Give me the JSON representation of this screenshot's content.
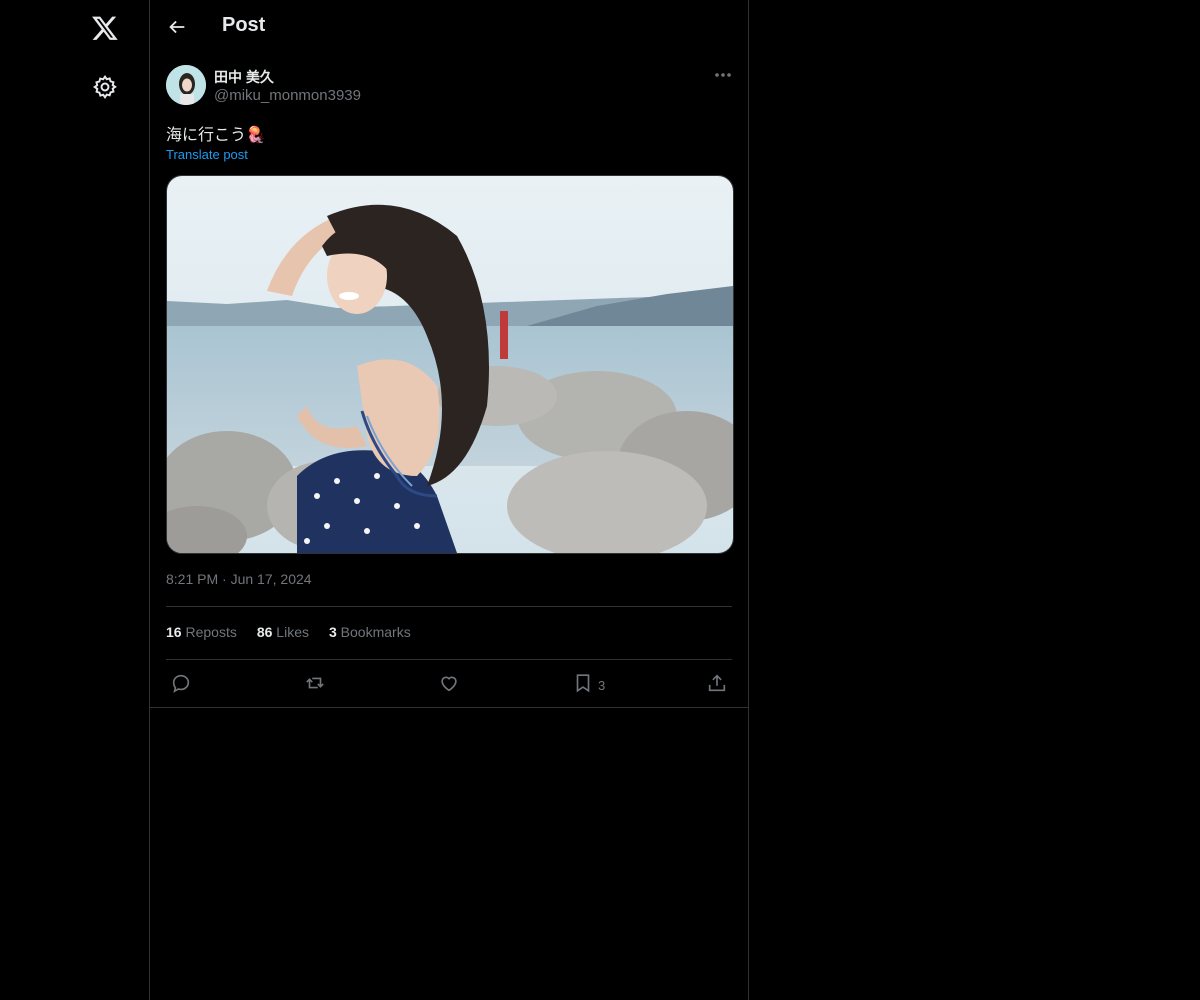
{
  "header": {
    "title": "Post"
  },
  "author": {
    "display_name": "田中 美久",
    "handle": "@miku_monmon3939"
  },
  "post": {
    "text": "海に行こう🪼",
    "translate_label": "Translate post",
    "time": "8:21 PM",
    "separator": "·",
    "date": "Jun 17, 2024"
  },
  "stats": {
    "reposts_count": "16",
    "reposts_label": "Reposts",
    "likes_count": "86",
    "likes_label": "Likes",
    "bookmarks_count": "3",
    "bookmarks_label": "Bookmarks"
  },
  "actions": {
    "bookmark_count": "3"
  },
  "icons": [
    "x-logo-icon",
    "gear-icon",
    "back-arrow-icon",
    "more-icon",
    "reply-icon",
    "repost-icon",
    "like-icon",
    "bookmark-icon",
    "share-icon"
  ],
  "colors": {
    "background": "#000000",
    "accent": "#1d9bf0",
    "secondary_text": "#71767b",
    "border": "#2f3336"
  }
}
